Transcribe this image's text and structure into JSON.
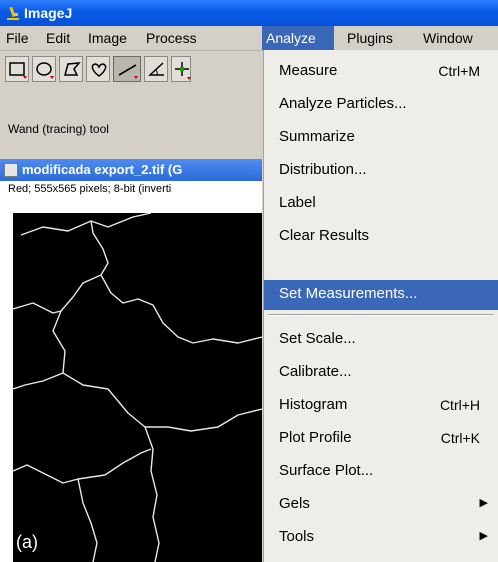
{
  "window": {
    "title": "ImageJ"
  },
  "menubar": {
    "items": [
      {
        "label": "File"
      },
      {
        "label": "Edit"
      },
      {
        "label": "Image"
      },
      {
        "label": "Process"
      },
      {
        "label": "Analyze"
      },
      {
        "label": "Plugins"
      },
      {
        "label": "Window"
      }
    ],
    "active": "Analyze"
  },
  "toolbar": {
    "tools": [
      "rectangle-tool-icon",
      "oval-tool-icon",
      "polygon-tool-icon",
      "freehand-tool-icon",
      "line-tool-icon",
      "angle-tool-icon",
      "point-tool-icon"
    ],
    "pressed": "line-tool-icon"
  },
  "status": {
    "text": "Wand (tracing) tool"
  },
  "image_window": {
    "title": "modificada export_2.tif (G",
    "info": "Red; 555x565 pixels; 8-bit (inverti",
    "caption": "(a)"
  },
  "analyze_menu": {
    "items": [
      {
        "label": "Measure",
        "shortcut": "Ctrl+M"
      },
      {
        "label": "Analyze Particles..."
      },
      {
        "label": "Summarize"
      },
      {
        "label": "Distribution..."
      },
      {
        "label": "Label"
      },
      {
        "label": "Clear Results"
      },
      {
        "label": "Set Measurements...",
        "selected": true
      },
      {
        "label": "Set Scale..."
      },
      {
        "label": "Calibrate..."
      },
      {
        "label": "Histogram",
        "shortcut": "Ctrl+H"
      },
      {
        "label": "Plot Profile",
        "shortcut": "Ctrl+K"
      },
      {
        "label": "Surface Plot..."
      },
      {
        "label": "Gels",
        "submenu": true
      },
      {
        "label": "Tools",
        "submenu": true
      }
    ]
  },
  "colors": {
    "title_bar": "#0a5ae6",
    "menu_highlight": "#3a67b8",
    "menu_background": "#eeede9",
    "canvas": "#000000"
  }
}
